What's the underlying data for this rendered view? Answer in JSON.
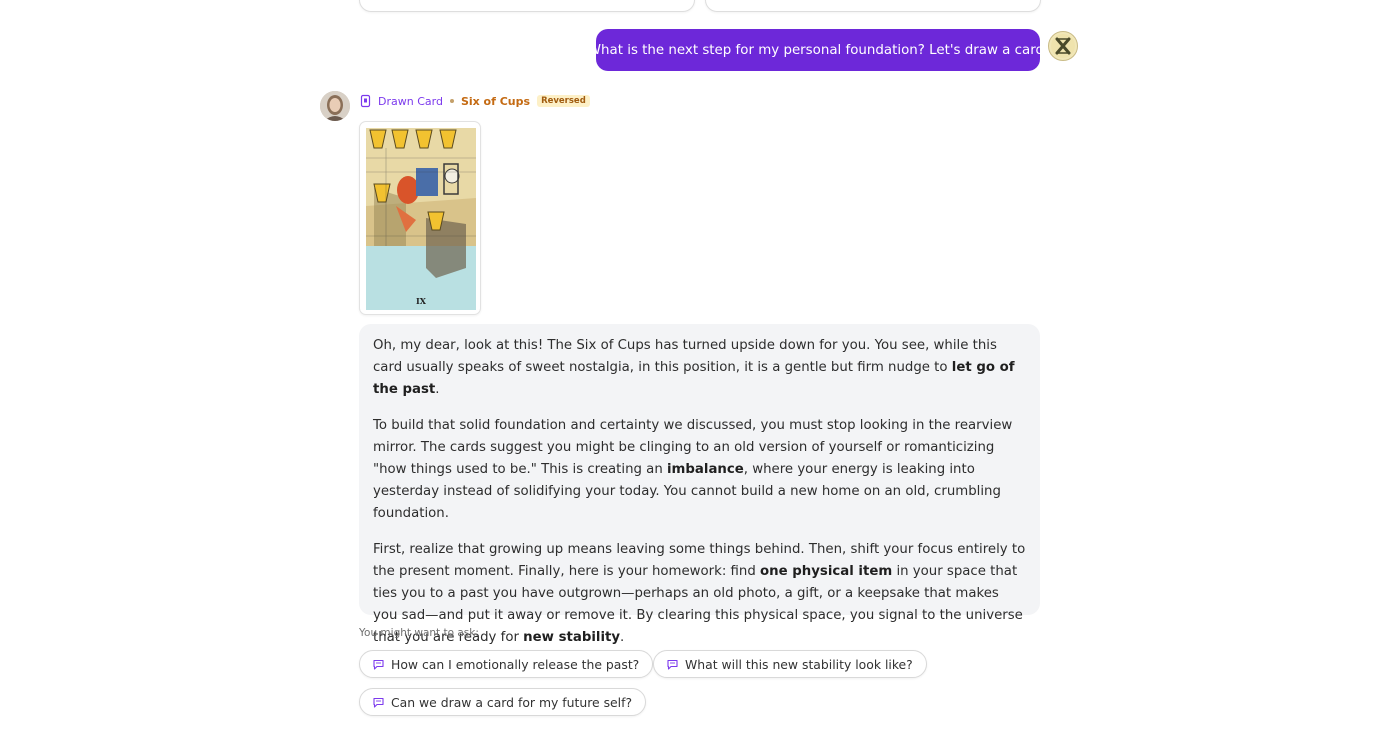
{
  "user_message": {
    "text": "What is the next step for my personal foundation? Let's draw a card."
  },
  "drawn_card": {
    "label": "Drawn Card",
    "name": "Six of Cups",
    "badge": "Reversed",
    "numeral": "IX"
  },
  "answer": {
    "p1_a": "Oh, my dear, look at this! The Six of Cups has turned upside down for you. You see, while this card usually speaks of sweet nostalgia, in this position, it is a gentle but firm nudge to ",
    "p1_b": "let go of the past",
    "p1_c": ".",
    "p2_a": "To build that solid foundation and certainty we discussed, you must stop looking in the rearview mirror. The cards suggest you might be clinging to an old version of yourself or romanticizing \"how things used to be.\" This is creating an ",
    "p2_b": "imbalance",
    "p2_c": ", where your energy is leaking into yesterday instead of solidifying your today. You cannot build a new home on an old, crumbling foundation.",
    "p3_a": "First, realize that growing up means leaving some things behind. Then, shift your focus entirely to the present moment. Finally, here is your homework: find ",
    "p3_b": "one physical item",
    "p3_c": " in your space that ties you to a past you have outgrown—perhaps an old photo, a gift, or a keepsake that makes you sad—and put it away or remove it. By clearing this physical space, you signal to the universe that you are ready for ",
    "p3_d": "new stability",
    "p3_e": "."
  },
  "suggestions": {
    "label": "You might want to ask:",
    "items": [
      "How can I emotionally release the past?",
      "What will this new stability look like?",
      "Can we draw a card for my future self?"
    ]
  },
  "icons": {
    "card": "card-icon",
    "chat": "chat-bubble-icon",
    "user_avatar": "user-avatar-icon",
    "bot_avatar": "reader-avatar"
  },
  "colors": {
    "accent": "#6d28d9",
    "card_name": "#c46a12",
    "badge_bg": "#fdf0c7",
    "answer_bg": "#f3f4f6"
  }
}
